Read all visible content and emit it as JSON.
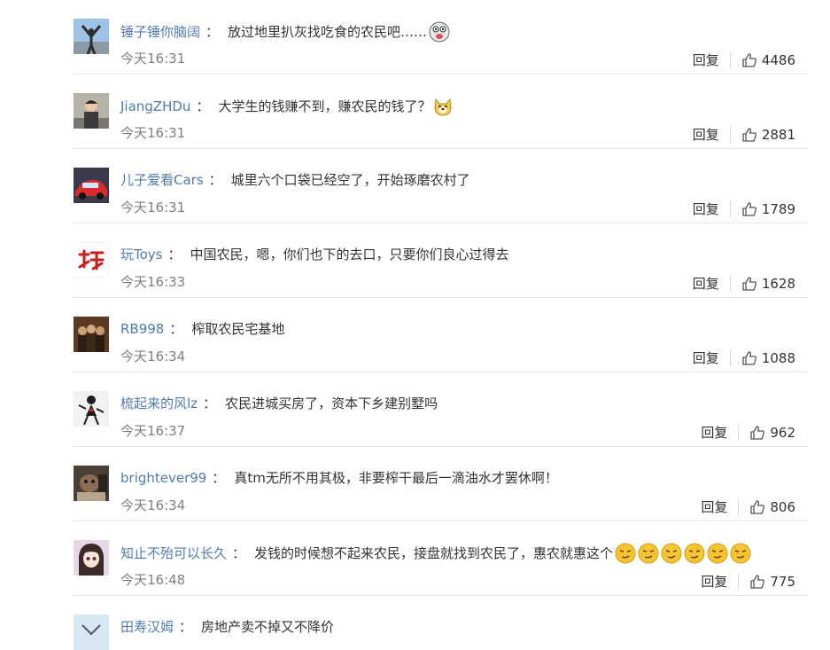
{
  "comments": [
    {
      "user": "锤子锤你脑阔",
      "text": "放过地里扒灰找吃食的农民吧……",
      "emoji": [
        "tongue"
      ],
      "time": "今天16:31",
      "reply": "回复",
      "likes": "4486"
    },
    {
      "user": "JiangZHDu",
      "text": "大学生的钱赚不到，赚农民的钱了？",
      "emoji": [
        "dog"
      ],
      "time": "今天16:31",
      "reply": "回复",
      "likes": "2881"
    },
    {
      "user": "儿子爱看Cars",
      "text": "城里六个口袋已经空了，开始琢磨农村了",
      "emoji": [],
      "time": "今天16:31",
      "reply": "回复",
      "likes": "1789"
    },
    {
      "user": "玩Toys",
      "text": "中国农民，嗯，你们也下的去口，只要你们良心过得去",
      "emoji": [],
      "time": "今天16:33",
      "reply": "回复",
      "likes": "1628"
    },
    {
      "user": "RB998",
      "text": "榨取农民宅基地",
      "emoji": [],
      "time": "今天16:34",
      "reply": "回复",
      "likes": "1088"
    },
    {
      "user": "梳起来的风lz",
      "text": "农民进城买房了，资本下乡建别墅吗",
      "emoji": [],
      "time": "今天16:37",
      "reply": "回复",
      "likes": "962"
    },
    {
      "user": "brightever99",
      "text": "真tm无所不用其极，非要榨干最后一滴油水才罢休啊！",
      "emoji": [],
      "time": "今天16:34",
      "reply": "回复",
      "likes": "806"
    },
    {
      "user": "知止不殆可以长久",
      "text": "发钱的时候想不起来农民，接盘就找到农民了，惠农就惠这个",
      "emoji": [
        "smirk",
        "smirk",
        "smirk",
        "smirk",
        "smirk",
        "smirk"
      ],
      "time": "今天16:48",
      "reply": "回复",
      "likes": "775"
    }
  ],
  "partial": {
    "user": "田寿汉姆",
    "text": "房地产卖不掉又不降价"
  },
  "colors": {
    "username": "#4f7bb3",
    "time": "#808080",
    "divider": "#e6e6e6"
  },
  "icons": {
    "like": "thumbs-up-icon"
  }
}
